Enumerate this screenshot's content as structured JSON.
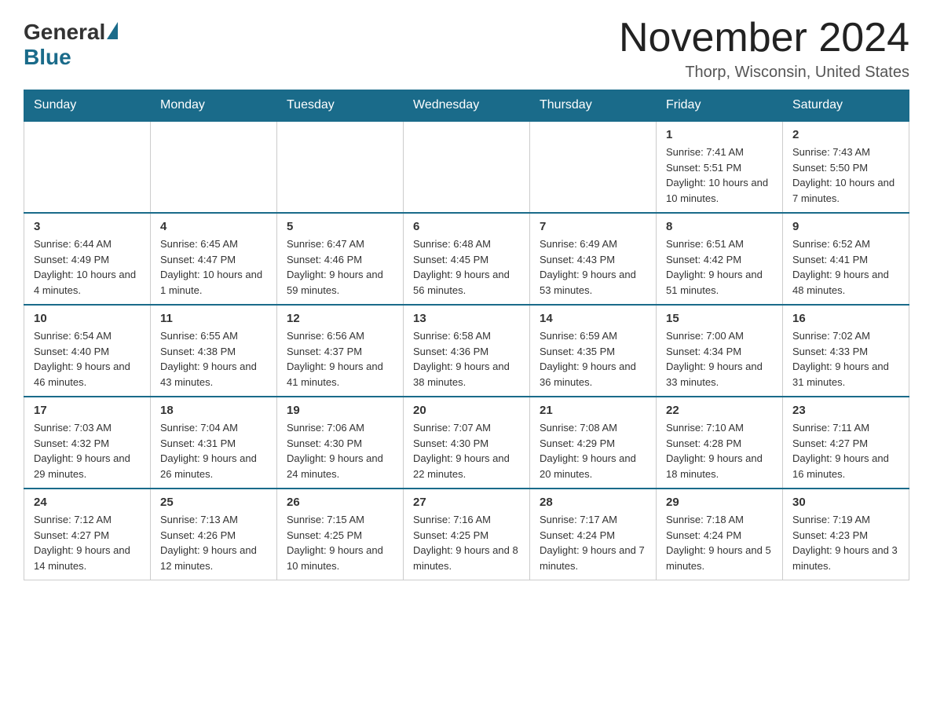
{
  "header": {
    "logo_general": "General",
    "logo_blue": "Blue",
    "month_title": "November 2024",
    "location": "Thorp, Wisconsin, United States"
  },
  "days_of_week": [
    "Sunday",
    "Monday",
    "Tuesday",
    "Wednesday",
    "Thursday",
    "Friday",
    "Saturday"
  ],
  "weeks": [
    [
      {
        "day": "",
        "sunrise": "",
        "sunset": "",
        "daylight": ""
      },
      {
        "day": "",
        "sunrise": "",
        "sunset": "",
        "daylight": ""
      },
      {
        "day": "",
        "sunrise": "",
        "sunset": "",
        "daylight": ""
      },
      {
        "day": "",
        "sunrise": "",
        "sunset": "",
        "daylight": ""
      },
      {
        "day": "",
        "sunrise": "",
        "sunset": "",
        "daylight": ""
      },
      {
        "day": "1",
        "sunrise": "Sunrise: 7:41 AM",
        "sunset": "Sunset: 5:51 PM",
        "daylight": "Daylight: 10 hours and 10 minutes."
      },
      {
        "day": "2",
        "sunrise": "Sunrise: 7:43 AM",
        "sunset": "Sunset: 5:50 PM",
        "daylight": "Daylight: 10 hours and 7 minutes."
      }
    ],
    [
      {
        "day": "3",
        "sunrise": "Sunrise: 6:44 AM",
        "sunset": "Sunset: 4:49 PM",
        "daylight": "Daylight: 10 hours and 4 minutes."
      },
      {
        "day": "4",
        "sunrise": "Sunrise: 6:45 AM",
        "sunset": "Sunset: 4:47 PM",
        "daylight": "Daylight: 10 hours and 1 minute."
      },
      {
        "day": "5",
        "sunrise": "Sunrise: 6:47 AM",
        "sunset": "Sunset: 4:46 PM",
        "daylight": "Daylight: 9 hours and 59 minutes."
      },
      {
        "day": "6",
        "sunrise": "Sunrise: 6:48 AM",
        "sunset": "Sunset: 4:45 PM",
        "daylight": "Daylight: 9 hours and 56 minutes."
      },
      {
        "day": "7",
        "sunrise": "Sunrise: 6:49 AM",
        "sunset": "Sunset: 4:43 PM",
        "daylight": "Daylight: 9 hours and 53 minutes."
      },
      {
        "day": "8",
        "sunrise": "Sunrise: 6:51 AM",
        "sunset": "Sunset: 4:42 PM",
        "daylight": "Daylight: 9 hours and 51 minutes."
      },
      {
        "day": "9",
        "sunrise": "Sunrise: 6:52 AM",
        "sunset": "Sunset: 4:41 PM",
        "daylight": "Daylight: 9 hours and 48 minutes."
      }
    ],
    [
      {
        "day": "10",
        "sunrise": "Sunrise: 6:54 AM",
        "sunset": "Sunset: 4:40 PM",
        "daylight": "Daylight: 9 hours and 46 minutes."
      },
      {
        "day": "11",
        "sunrise": "Sunrise: 6:55 AM",
        "sunset": "Sunset: 4:38 PM",
        "daylight": "Daylight: 9 hours and 43 minutes."
      },
      {
        "day": "12",
        "sunrise": "Sunrise: 6:56 AM",
        "sunset": "Sunset: 4:37 PM",
        "daylight": "Daylight: 9 hours and 41 minutes."
      },
      {
        "day": "13",
        "sunrise": "Sunrise: 6:58 AM",
        "sunset": "Sunset: 4:36 PM",
        "daylight": "Daylight: 9 hours and 38 minutes."
      },
      {
        "day": "14",
        "sunrise": "Sunrise: 6:59 AM",
        "sunset": "Sunset: 4:35 PM",
        "daylight": "Daylight: 9 hours and 36 minutes."
      },
      {
        "day": "15",
        "sunrise": "Sunrise: 7:00 AM",
        "sunset": "Sunset: 4:34 PM",
        "daylight": "Daylight: 9 hours and 33 minutes."
      },
      {
        "day": "16",
        "sunrise": "Sunrise: 7:02 AM",
        "sunset": "Sunset: 4:33 PM",
        "daylight": "Daylight: 9 hours and 31 minutes."
      }
    ],
    [
      {
        "day": "17",
        "sunrise": "Sunrise: 7:03 AM",
        "sunset": "Sunset: 4:32 PM",
        "daylight": "Daylight: 9 hours and 29 minutes."
      },
      {
        "day": "18",
        "sunrise": "Sunrise: 7:04 AM",
        "sunset": "Sunset: 4:31 PM",
        "daylight": "Daylight: 9 hours and 26 minutes."
      },
      {
        "day": "19",
        "sunrise": "Sunrise: 7:06 AM",
        "sunset": "Sunset: 4:30 PM",
        "daylight": "Daylight: 9 hours and 24 minutes."
      },
      {
        "day": "20",
        "sunrise": "Sunrise: 7:07 AM",
        "sunset": "Sunset: 4:30 PM",
        "daylight": "Daylight: 9 hours and 22 minutes."
      },
      {
        "day": "21",
        "sunrise": "Sunrise: 7:08 AM",
        "sunset": "Sunset: 4:29 PM",
        "daylight": "Daylight: 9 hours and 20 minutes."
      },
      {
        "day": "22",
        "sunrise": "Sunrise: 7:10 AM",
        "sunset": "Sunset: 4:28 PM",
        "daylight": "Daylight: 9 hours and 18 minutes."
      },
      {
        "day": "23",
        "sunrise": "Sunrise: 7:11 AM",
        "sunset": "Sunset: 4:27 PM",
        "daylight": "Daylight: 9 hours and 16 minutes."
      }
    ],
    [
      {
        "day": "24",
        "sunrise": "Sunrise: 7:12 AM",
        "sunset": "Sunset: 4:27 PM",
        "daylight": "Daylight: 9 hours and 14 minutes."
      },
      {
        "day": "25",
        "sunrise": "Sunrise: 7:13 AM",
        "sunset": "Sunset: 4:26 PM",
        "daylight": "Daylight: 9 hours and 12 minutes."
      },
      {
        "day": "26",
        "sunrise": "Sunrise: 7:15 AM",
        "sunset": "Sunset: 4:25 PM",
        "daylight": "Daylight: 9 hours and 10 minutes."
      },
      {
        "day": "27",
        "sunrise": "Sunrise: 7:16 AM",
        "sunset": "Sunset: 4:25 PM",
        "daylight": "Daylight: 9 hours and 8 minutes."
      },
      {
        "day": "28",
        "sunrise": "Sunrise: 7:17 AM",
        "sunset": "Sunset: 4:24 PM",
        "daylight": "Daylight: 9 hours and 7 minutes."
      },
      {
        "day": "29",
        "sunrise": "Sunrise: 7:18 AM",
        "sunset": "Sunset: 4:24 PM",
        "daylight": "Daylight: 9 hours and 5 minutes."
      },
      {
        "day": "30",
        "sunrise": "Sunrise: 7:19 AM",
        "sunset": "Sunset: 4:23 PM",
        "daylight": "Daylight: 9 hours and 3 minutes."
      }
    ]
  ]
}
